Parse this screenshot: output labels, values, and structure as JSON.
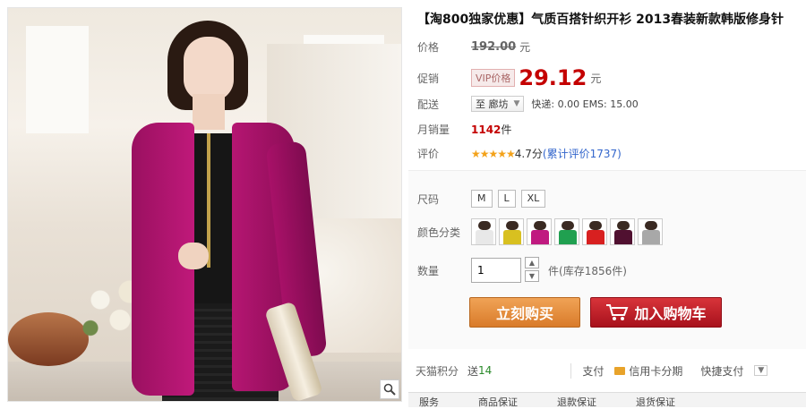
{
  "product": {
    "title": "【淘800独家优惠】气质百搭针织开衫 2013春装新款韩版修身针"
  },
  "price": {
    "label": "价格",
    "original": "192.00",
    "unit": "元"
  },
  "promo": {
    "label": "促销",
    "vip_tag": "VIP价格",
    "value": "29.12",
    "unit": "元"
  },
  "delivery": {
    "label": "配送",
    "dest": "至 廊坊",
    "info": "快递: 0.00 EMS: 15.00"
  },
  "sales": {
    "label": "月销量",
    "count": "1142",
    "unit": "件"
  },
  "review": {
    "label": "评价",
    "stars": "★★★★★",
    "score": "4.7分",
    "link": "(累计评价1737)"
  },
  "size": {
    "label": "尺码",
    "options": [
      "M",
      "L",
      "XL"
    ]
  },
  "color": {
    "label": "颜色分类",
    "swatches": [
      "#e8e8e8",
      "#d8c020",
      "#c01a80",
      "#20a050",
      "#d82020",
      "#501030",
      "#a8a8a8"
    ]
  },
  "quantity": {
    "label": "数量",
    "value": "1",
    "unit": "件",
    "stock": "(库存1856件)"
  },
  "buttons": {
    "buy": "立刻购买",
    "cart": "加入购物车"
  },
  "footer": {
    "points_label": "天猫积分",
    "points_text": "送",
    "points_value": "14",
    "pay_label": "支付",
    "credit": "信用卡分期",
    "quick": "快捷支付"
  },
  "tabs": [
    "服务",
    "商品保证",
    "退款保证",
    "退货保证"
  ]
}
